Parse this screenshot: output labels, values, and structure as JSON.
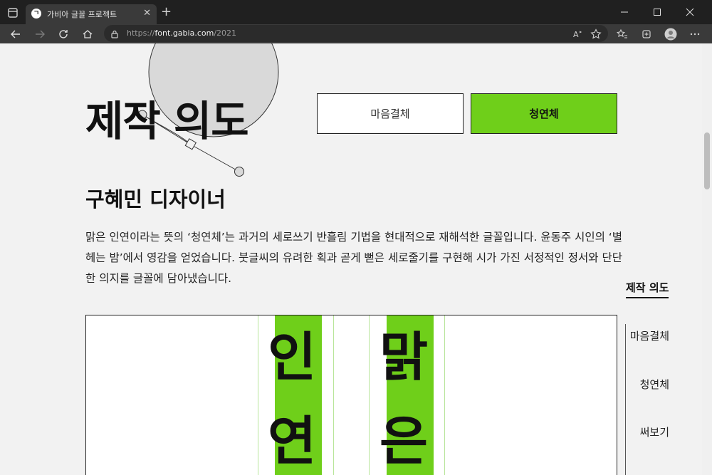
{
  "browser": {
    "tab_title": "가비아 글꼴 프로젝트",
    "favicon_letter": "ㄱ",
    "url_scheme": "https://",
    "url_host": "font.gabia.com",
    "url_path": "/2021",
    "new_tab_symbol": "+",
    "tab_close_symbol": "✕"
  },
  "page": {
    "section_title": "제작 의도",
    "font_buttons": [
      {
        "label": "마음결체",
        "active": false
      },
      {
        "label": "청연체",
        "active": true
      }
    ],
    "designer_name": "구혜민 디자이너",
    "description": "맑은 인연이라는 뜻의 ‘청연체’는 과거의 세로쓰기 반흘림 기법을 현대적으로 재해석한 글꼴입니다. 윤동주 시인의 ‘별 헤는 밤’에서 영감을 얻었습니다. 붓글씨의 유려한 획과 곧게 뻗은 세로줄기를 구현해 시가 가진 서정적인 정서와 단단한 의지를 글꼴에 담아냈습니다.",
    "showcase_glyphs": {
      "col1_top": "인",
      "col1_bottom": "연",
      "col2_top": "맑",
      "col2_bottom": "은"
    }
  },
  "side_nav": {
    "current": "제작 의도",
    "items": [
      "마음결체",
      "청연체",
      "써보기"
    ]
  },
  "colors": {
    "accent_green": "#6fcf1a",
    "page_bg": "#f2f2f2",
    "chrome_dark": "#202020"
  }
}
